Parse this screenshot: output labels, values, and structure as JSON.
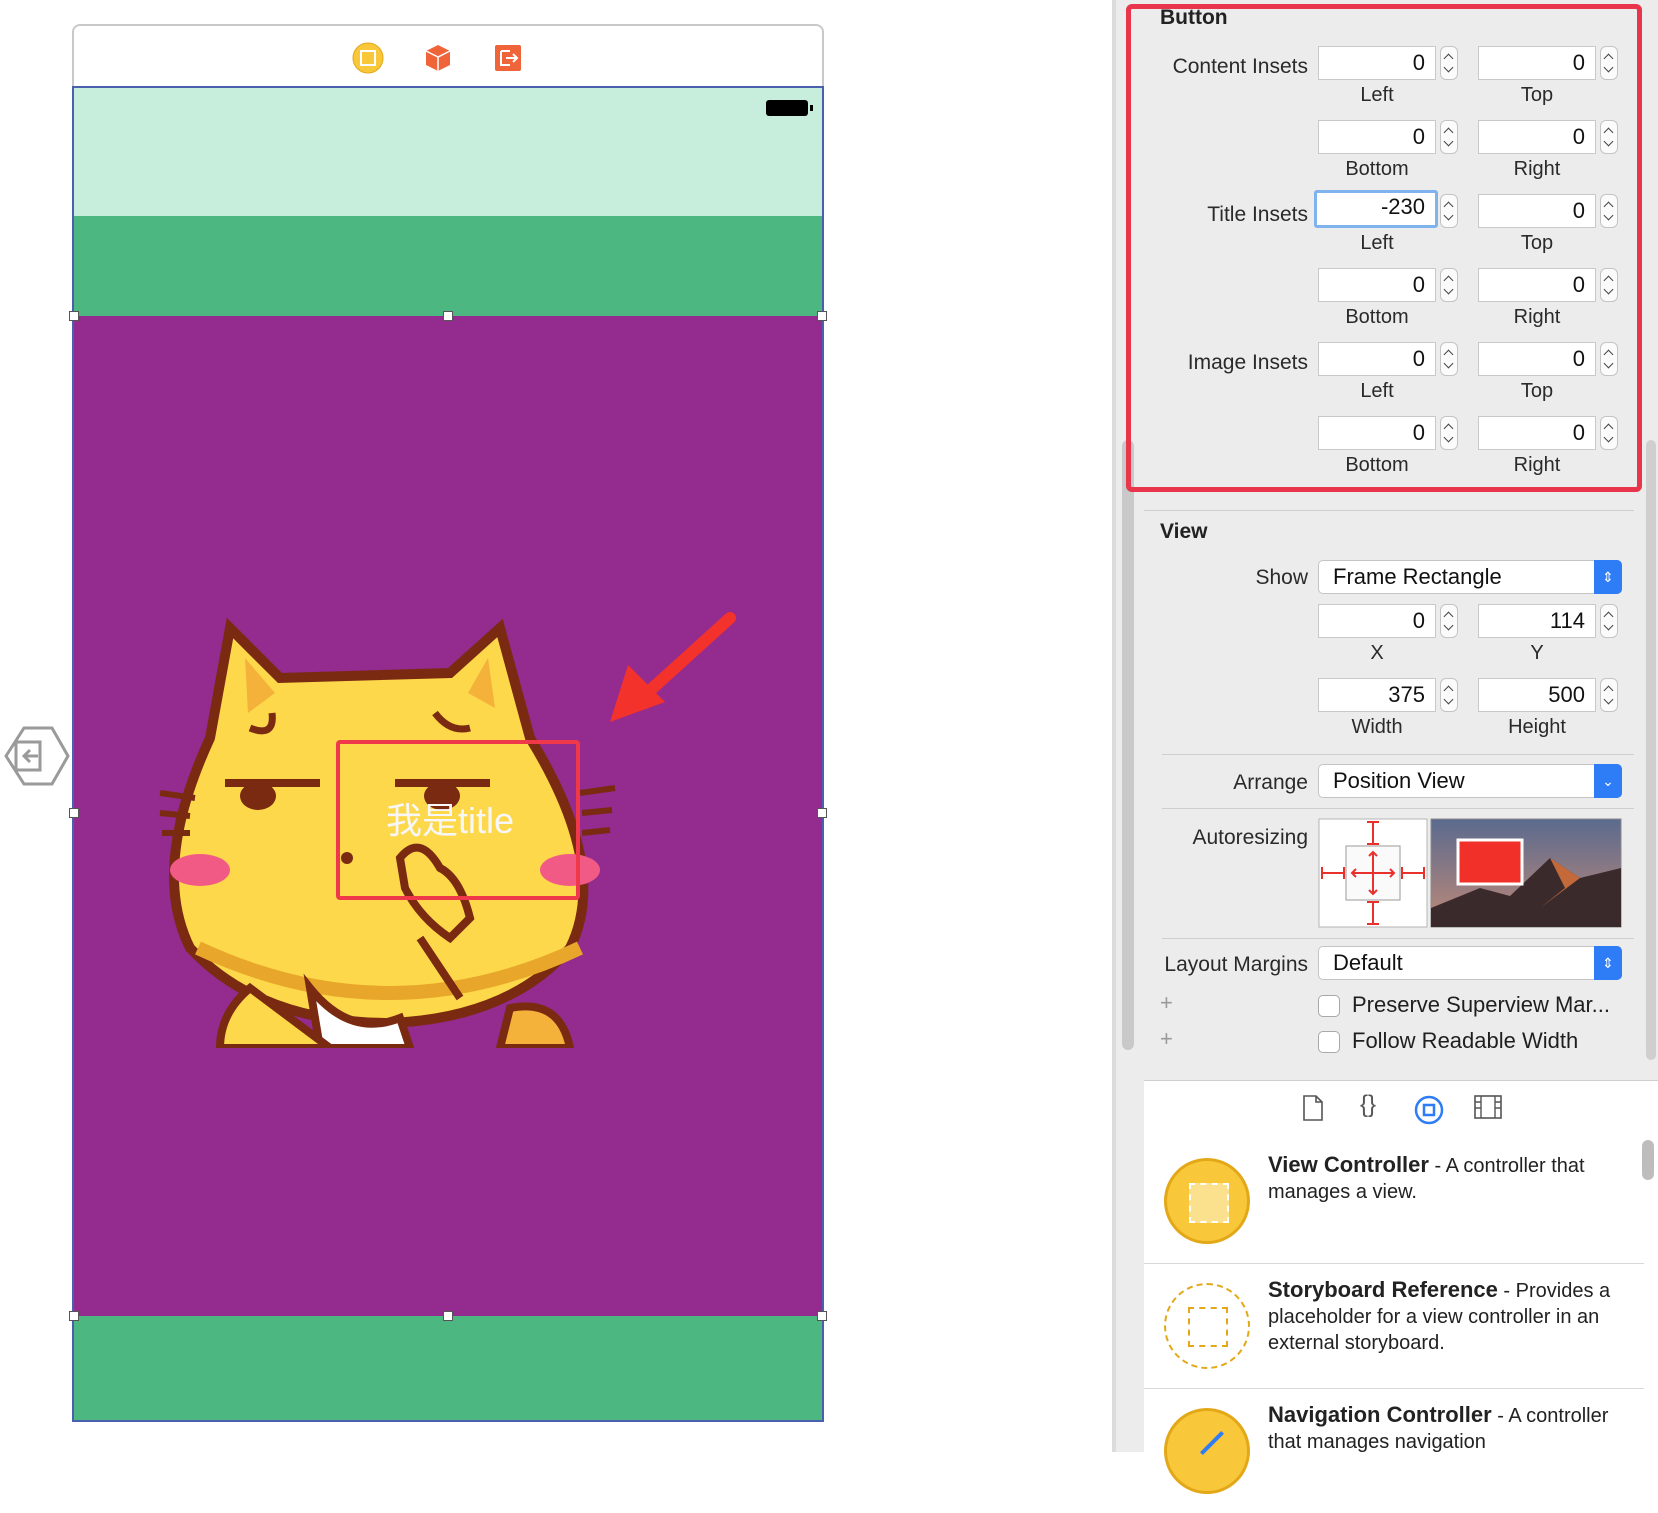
{
  "canvas": {
    "button_title": "我是title"
  },
  "inspector": {
    "button_section": {
      "title": "Button",
      "content_insets": {
        "label": "Content Insets",
        "left": "0",
        "top": "0",
        "bottom": "0",
        "right": "0"
      },
      "title_insets": {
        "label": "Title Insets",
        "left": "-230",
        "top": "0",
        "bottom": "0",
        "right": "0"
      },
      "image_insets": {
        "label": "Image Insets",
        "left": "0",
        "top": "0",
        "bottom": "0",
        "right": "0"
      },
      "sub_labels": {
        "left": "Left",
        "top": "Top",
        "bottom": "Bottom",
        "right": "Right"
      }
    },
    "view_section": {
      "title": "View",
      "show_label": "Show",
      "show_value": "Frame Rectangle",
      "x": "0",
      "y": "114",
      "width": "375",
      "height": "500",
      "x_label": "X",
      "y_label": "Y",
      "width_label": "Width",
      "height_label": "Height",
      "arrange_label": "Arrange",
      "arrange_value": "Position View",
      "autoresizing_label": "Autoresizing",
      "layout_margins_label": "Layout Margins",
      "layout_margins_value": "Default",
      "preserve_label": "Preserve Superview Mar...",
      "follow_label": "Follow Readable Width"
    },
    "library": [
      {
        "name": "View Controller",
        "desc": " - A controller that manages a view."
      },
      {
        "name": "Storyboard Reference",
        "desc": " - Provides a placeholder for a view controller in an external storyboard."
      },
      {
        "name": "Navigation Controller",
        "desc": " - A controller that manages navigation"
      }
    ]
  },
  "colors": {
    "view_bg": "#942b8f",
    "nav_green": "#4cb780",
    "status_mint": "#c7eedc",
    "highlight_red": "#e8354b",
    "accent_blue": "#2e7df6"
  }
}
